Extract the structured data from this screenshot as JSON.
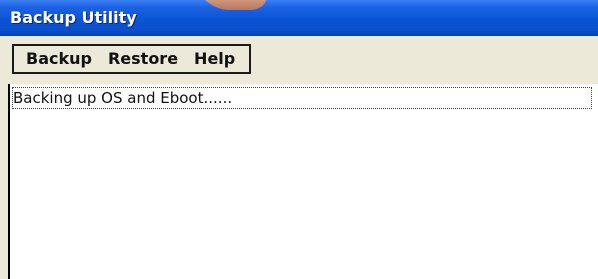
{
  "window": {
    "title": "Backup Utility"
  },
  "menu": {
    "items": [
      "Backup",
      "Restore",
      "Help"
    ]
  },
  "status": {
    "message": "Backing up OS and Eboot......"
  },
  "colors": {
    "title_bar": "#0a54d6",
    "window_background": "#ece9d8",
    "content_background": "#ffffff"
  }
}
